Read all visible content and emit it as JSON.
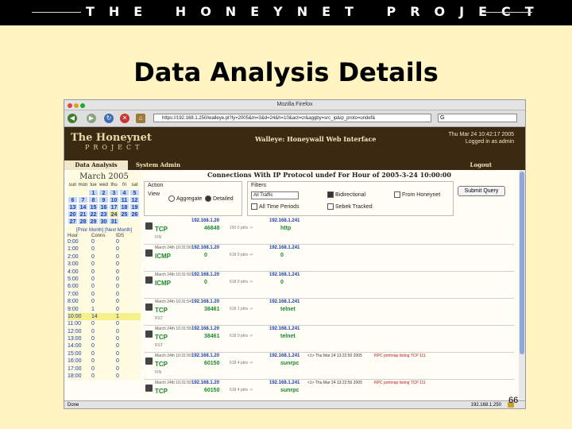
{
  "banner": {
    "text": "THE HONEYNET PROJECT"
  },
  "slide": {
    "title": "Data Analysis Details",
    "page_number": "66"
  },
  "browser": {
    "window_title": "Mozilla Firefox",
    "url": "https://192.168.1.250/walleye.pl?ly=2005&m=3&d=24&h=10&act=cr&aggby=src_ip&ip_proto=undef&",
    "search_glyph": "G",
    "status_left": "Done",
    "status_right": "192.168.1.250"
  },
  "app": {
    "logo_main": "The Honeynet",
    "logo_sub": "PROJECT",
    "header_title": "Walleye: Honeywall Web Interface",
    "header_time": "Thu Mar 24 10:42:17 2005",
    "header_user": "Logged in as admin",
    "tabs": [
      {
        "label": "Data Analysis"
      },
      {
        "label": "System Admin"
      }
    ],
    "logout": "Logout"
  },
  "calendar": {
    "month": "March 2005",
    "weekdays": [
      "sun",
      "mon",
      "tue",
      "wed",
      "thu",
      "fri",
      "sat"
    ],
    "days": [
      [
        "",
        "",
        "1",
        "2",
        "3",
        "4",
        "5"
      ],
      [
        "6",
        "7",
        "8",
        "9",
        "10",
        "11",
        "12"
      ],
      [
        "13",
        "14",
        "15",
        "16",
        "17",
        "18",
        "19"
      ],
      [
        "20",
        "21",
        "22",
        "23",
        "24",
        "25",
        "26"
      ],
      [
        "27",
        "28",
        "29",
        "30",
        "31",
        "",
        ""
      ]
    ],
    "selected_day": "24",
    "prev_month": "[Prior Month]",
    "next_month": "[Next Month]"
  },
  "hours": {
    "headers": [
      "Hour",
      "Conns",
      "IDS"
    ],
    "rows": [
      [
        "0:00",
        "0",
        "0"
      ],
      [
        "1:00",
        "0",
        "0"
      ],
      [
        "2:00",
        "0",
        "0"
      ],
      [
        "3:00",
        "0",
        "0"
      ],
      [
        "4:00",
        "0",
        "0"
      ],
      [
        "5:00",
        "0",
        "0"
      ],
      [
        "6:00",
        "0",
        "0"
      ],
      [
        "7:00",
        "0",
        "0"
      ],
      [
        "8:00",
        "0",
        "0"
      ],
      [
        "9:00",
        "1",
        "0"
      ],
      [
        "10:00",
        "14",
        "1"
      ],
      [
        "11:00",
        "0",
        "0"
      ],
      [
        "12:00",
        "0",
        "0"
      ],
      [
        "13:00",
        "0",
        "0"
      ],
      [
        "14:00",
        "0",
        "0"
      ],
      [
        "15:00",
        "0",
        "0"
      ],
      [
        "16:00",
        "0",
        "0"
      ],
      [
        "17:00",
        "0",
        "0"
      ],
      [
        "18:00",
        "0",
        "0"
      ]
    ],
    "highlight": "10:00"
  },
  "filters": {
    "title": "Connections With IP Protocol undef For Hour of 2005-3-24 10:00:00",
    "action_label": "Action",
    "view_label": "View",
    "aggregate_label": "Aggregate",
    "detailed_label": "Detailed",
    "filters_label": "Filters",
    "traffic_select": "All Traffic",
    "bidirectional_label": "Bidirectional",
    "from_honeynet_label": "From Honeynet",
    "all_time_label": "All Time Periods",
    "sebek_label": "Sebek Tracked",
    "submit_label": "Submit Query"
  },
  "records": [
    {
      "time": "",
      "src_ip": "192.168.1.20",
      "proto": "TCP",
      "sport": "46848",
      "flags": "FIN",
      "mid": "150 0 pkts ->",
      "dst_ip": "192.168.1.241",
      "dport": "http",
      "alert": "",
      "alert_msg": ""
    },
    {
      "time": "March 24th 10:31:50",
      "src_ip": "192.168.1.20",
      "proto": "ICMP",
      "sport": "0",
      "flags": "",
      "mid": "618 0 pkts ->",
      "dst_ip": "192.168.1.241",
      "dport": "0",
      "alert": "",
      "alert_msg": ""
    },
    {
      "time": "March 24th 10:31:50",
      "src_ip": "192.168.1.20",
      "proto": "ICMP",
      "sport": "0",
      "flags": "",
      "mid": "618 0 pkts ->",
      "dst_ip": "192.168.1.241",
      "dport": "0",
      "alert": "",
      "alert_msg": ""
    },
    {
      "time": "March 24th 10:31:54",
      "src_ip": "192.168.1.20",
      "proto": "TCP",
      "sport": "38461",
      "flags": "RST",
      "mid": "618 1 pkts ->",
      "dst_ip": "192.168.1.241",
      "dport": "telnet",
      "alert": "",
      "alert_msg": ""
    },
    {
      "time": "March 24th 10:31:55",
      "src_ip": "192.168.1.20",
      "proto": "TCP",
      "sport": "38461",
      "flags": "RST",
      "mid": "618 0 pkts ->",
      "dst_ip": "192.168.1.241",
      "dport": "telnet",
      "alert": "",
      "alert_msg": ""
    },
    {
      "time": "March 24th 10:31:50",
      "src_ip": "192.168.1.20",
      "proto": "TCP",
      "sport": "60150",
      "flags": "FIN",
      "mid": "618 4 pkts ->",
      "dst_ip": "192.168.1.241",
      "dport": "sunrpc",
      "alert": "<1> Thu Mar 24 13:22:50 2005",
      "alert_msg": "RPC portmap listing TCP 111"
    },
    {
      "time": "March 24th 10:31:50",
      "src_ip": "192.168.1.20",
      "proto": "TCP",
      "sport": "60150",
      "flags": "FIN",
      "mid": "618 4 pkts ->",
      "dst_ip": "192.168.1.241",
      "dport": "sunrpc",
      "alert": "<1> Thu Mar 24 13:22:50 2005",
      "alert_msg": "RPC portmap listing TCP 111"
    }
  ]
}
